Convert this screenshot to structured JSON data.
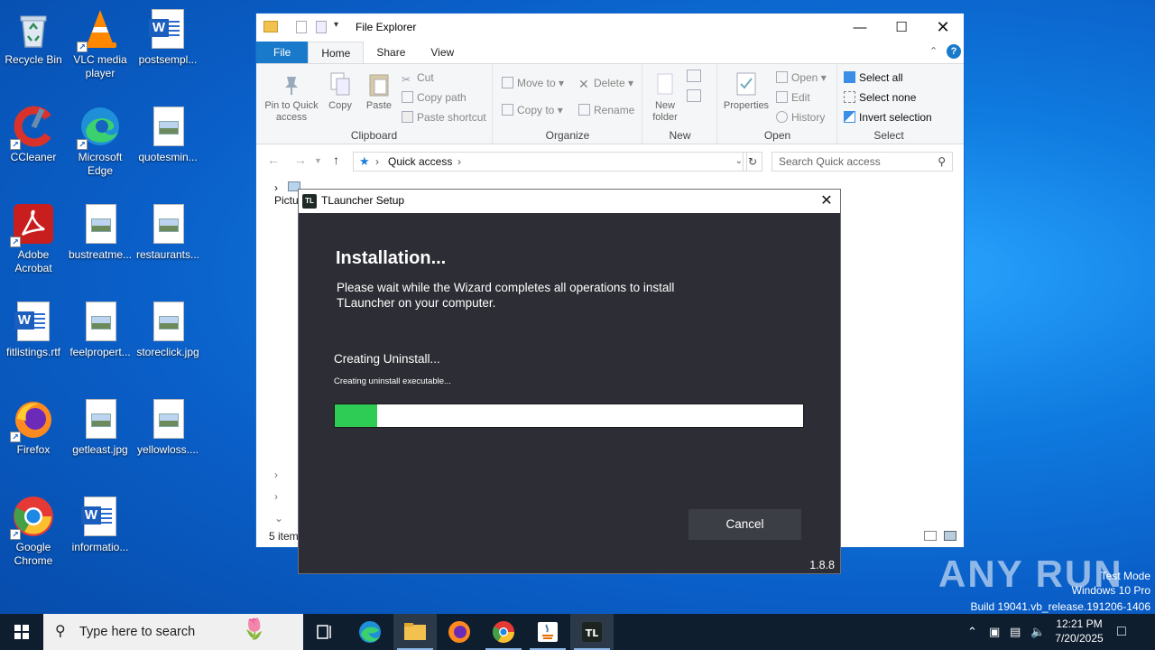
{
  "desktop": {
    "icons": [
      {
        "label": "Recycle Bin",
        "icon": "recycle-bin-icon"
      },
      {
        "label": "VLC media player",
        "icon": "vlc-icon"
      },
      {
        "label": "postsempl...",
        "icon": "word-doc-icon"
      },
      {
        "label": "CCleaner",
        "icon": "ccleaner-icon"
      },
      {
        "label": "Microsoft Edge",
        "icon": "edge-icon"
      },
      {
        "label": "quotesmin...",
        "icon": "image-file-icon"
      },
      {
        "label": "Adobe Acrobat",
        "icon": "acrobat-icon"
      },
      {
        "label": "bustreatme...",
        "icon": "image-file-icon"
      },
      {
        "label": "restaurants...",
        "icon": "image-file-icon"
      },
      {
        "label": "fitlistings.rtf",
        "icon": "word-doc-icon"
      },
      {
        "label": "feelpropert...",
        "icon": "image-file-icon"
      },
      {
        "label": "storeclick.jpg",
        "icon": "image-file-icon"
      },
      {
        "label": "Firefox",
        "icon": "firefox-icon"
      },
      {
        "label": "getleast.jpg",
        "icon": "image-file-icon"
      },
      {
        "label": "yellowloss....",
        "icon": "image-file-icon"
      },
      {
        "label": "Google Chrome",
        "icon": "chrome-icon"
      },
      {
        "label": "informatio...",
        "icon": "word-doc-icon"
      }
    ]
  },
  "explorer": {
    "title": "File Explorer",
    "tabs": [
      "File",
      "Home",
      "Share",
      "View"
    ],
    "ribbon": {
      "clipboard": {
        "group": "Clipboard",
        "pin": "Pin to Quick access",
        "copy": "Copy",
        "paste": "Paste",
        "cut": "Cut",
        "copy_path": "Copy path",
        "paste_shortcut": "Paste shortcut"
      },
      "organize": {
        "group": "Organize",
        "move_to": "Move to",
        "copy_to": "Copy to",
        "delete": "Delete",
        "rename": "Rename"
      },
      "new": {
        "group": "New",
        "new_folder": "New folder"
      },
      "open": {
        "group": "Open",
        "properties": "Properties",
        "open": "Open",
        "edit": "Edit",
        "history": "History"
      },
      "select": {
        "group": "Select",
        "select_all": "Select all",
        "select_none": "Select none",
        "invert": "Invert selection"
      }
    },
    "address": "Quick access",
    "search_placeholder": "Search Quick access",
    "tree_first": "Pictures",
    "status": "5 item"
  },
  "setup": {
    "title": "TLauncher Setup",
    "logo": "TL",
    "heading": "Installation...",
    "description": "Please wait while the Wizard completes all operations to install TLauncher on your computer.",
    "status": "Creating Uninstall...",
    "substatus": "Creating uninstall executable...",
    "progress_percent": 9,
    "cancel": "Cancel",
    "version": "1.8.8"
  },
  "watermark": {
    "brand": "ANY RUN",
    "mode": "Test Mode",
    "os": "Windows 10 Pro",
    "build": "Build 19041.vb_release.191206-1406"
  },
  "taskbar": {
    "search_placeholder": "Type here to search",
    "time": "12:21 PM",
    "date": "7/20/2025"
  },
  "colors": {
    "accent": "#1979ca",
    "progress": "#2ecc54",
    "dialog_bg": "#2c2d35",
    "taskbar": "#0e1e2f"
  }
}
